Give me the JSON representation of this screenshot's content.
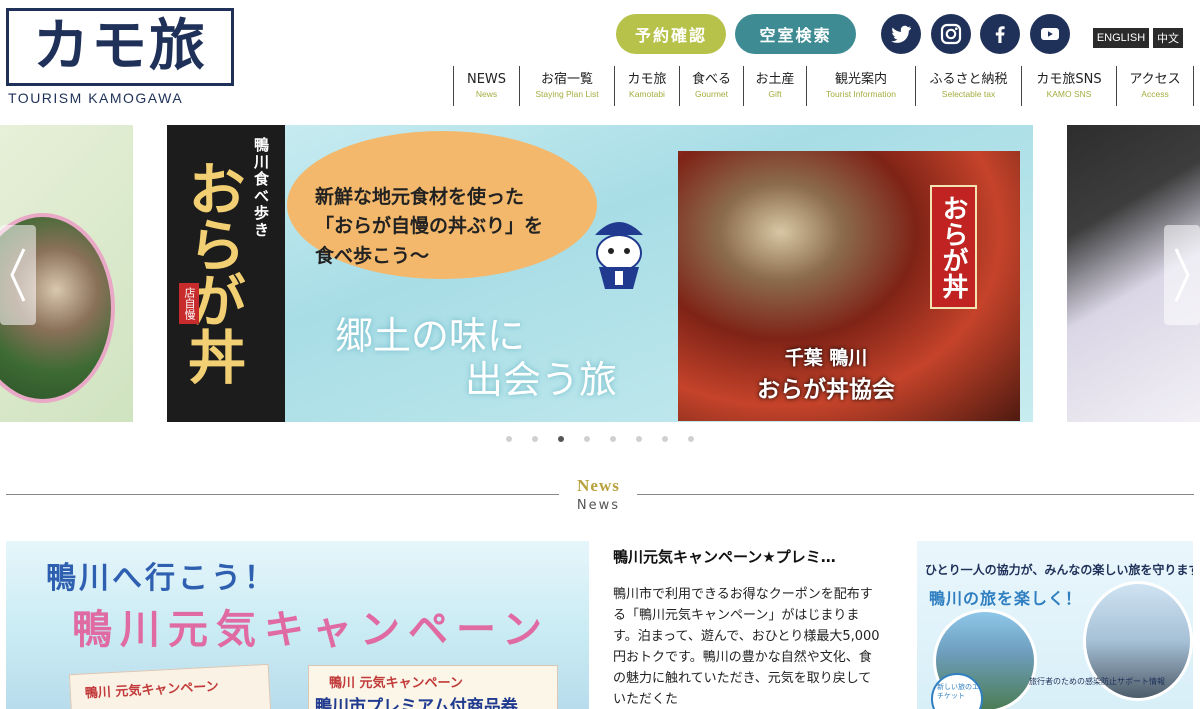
{
  "header": {
    "logo": {
      "main": "カモ旅",
      "sub": "TOURISM KAMOGAWA"
    },
    "buttons": {
      "reserve": "予約確認",
      "vacancy": "空室検索"
    },
    "languages": {
      "english": "ENGLISH",
      "chinese": "中文"
    },
    "sns": [
      "twitter-icon",
      "instagram-icon",
      "facebook-icon",
      "youtube-icon"
    ]
  },
  "nav": [
    {
      "ja": "NEWS",
      "en": "News"
    },
    {
      "ja": "お宿一覧",
      "en": "Staying Plan List"
    },
    {
      "ja": "カモ旅",
      "en": "Kamotabi"
    },
    {
      "ja": "食べる",
      "en": "Gourmet"
    },
    {
      "ja": "お土産",
      "en": "Gift"
    },
    {
      "ja": "観光案内",
      "en": "Tourist Information"
    },
    {
      "ja": "ふるさと納税",
      "en": "Selectable tax"
    },
    {
      "ja": "カモ旅SNS",
      "en": "KAMO SNS"
    },
    {
      "ja": "アクセス",
      "en": "Access"
    }
  ],
  "slider": {
    "banner": {
      "vertical_sub": "鴨川食べ歩き",
      "vertical_title": "おらが丼",
      "tag": "店自慢",
      "bubble_line1": "新鮮な地元食材を使った",
      "bubble_line2": "「おらが自慢の丼ぶり」を",
      "bubble_line3": "食べ歩こう〜",
      "copy_line1": "郷土の味に",
      "copy_line2": "出会う旅",
      "flag": "おらが丼",
      "assoc_line1": "千葉 鴨川",
      "assoc_line2": "おらが丼協会"
    },
    "dots_count": 8,
    "active_dot": 3
  },
  "news": {
    "heading_en": "News",
    "heading_ja": "News",
    "card": {
      "line1": "鴨川へ行こう！",
      "line2": "鴨川元気キャンペーン",
      "ticket1": "鴨川 元気キャンペーン",
      "ticket2a": "鴨川 元気キャンペーン",
      "ticket2b": "鴨川市プレミアム付商品券"
    },
    "title": "鴨川元気キャンペーン★プレミ…",
    "body": "鴨川市で利用できるお得なクーポンを配布する「鴨川元気キャンペーン」がはじまります。泊まって、遊んで、おひとり様最大5,000円おトクです。鴨川の豊かな自然や文化、食の魅力に触れていただき、元気を取り戻していただくた",
    "side": {
      "top": "ひとり一人の協力が、みんなの楽しい旅を守ります",
      "mid": "鴨川の旅を楽しく！",
      "badge": "新しい旅のエチケット",
      "note": "旅行者のための感染防止サポート情報"
    }
  },
  "colors": {
    "navy": "#1f3159",
    "reserve": "#b7c24b",
    "vacancy": "#3f8b93",
    "nav_sub": "#a3ad3e",
    "news_heading": "#b7a23e"
  }
}
